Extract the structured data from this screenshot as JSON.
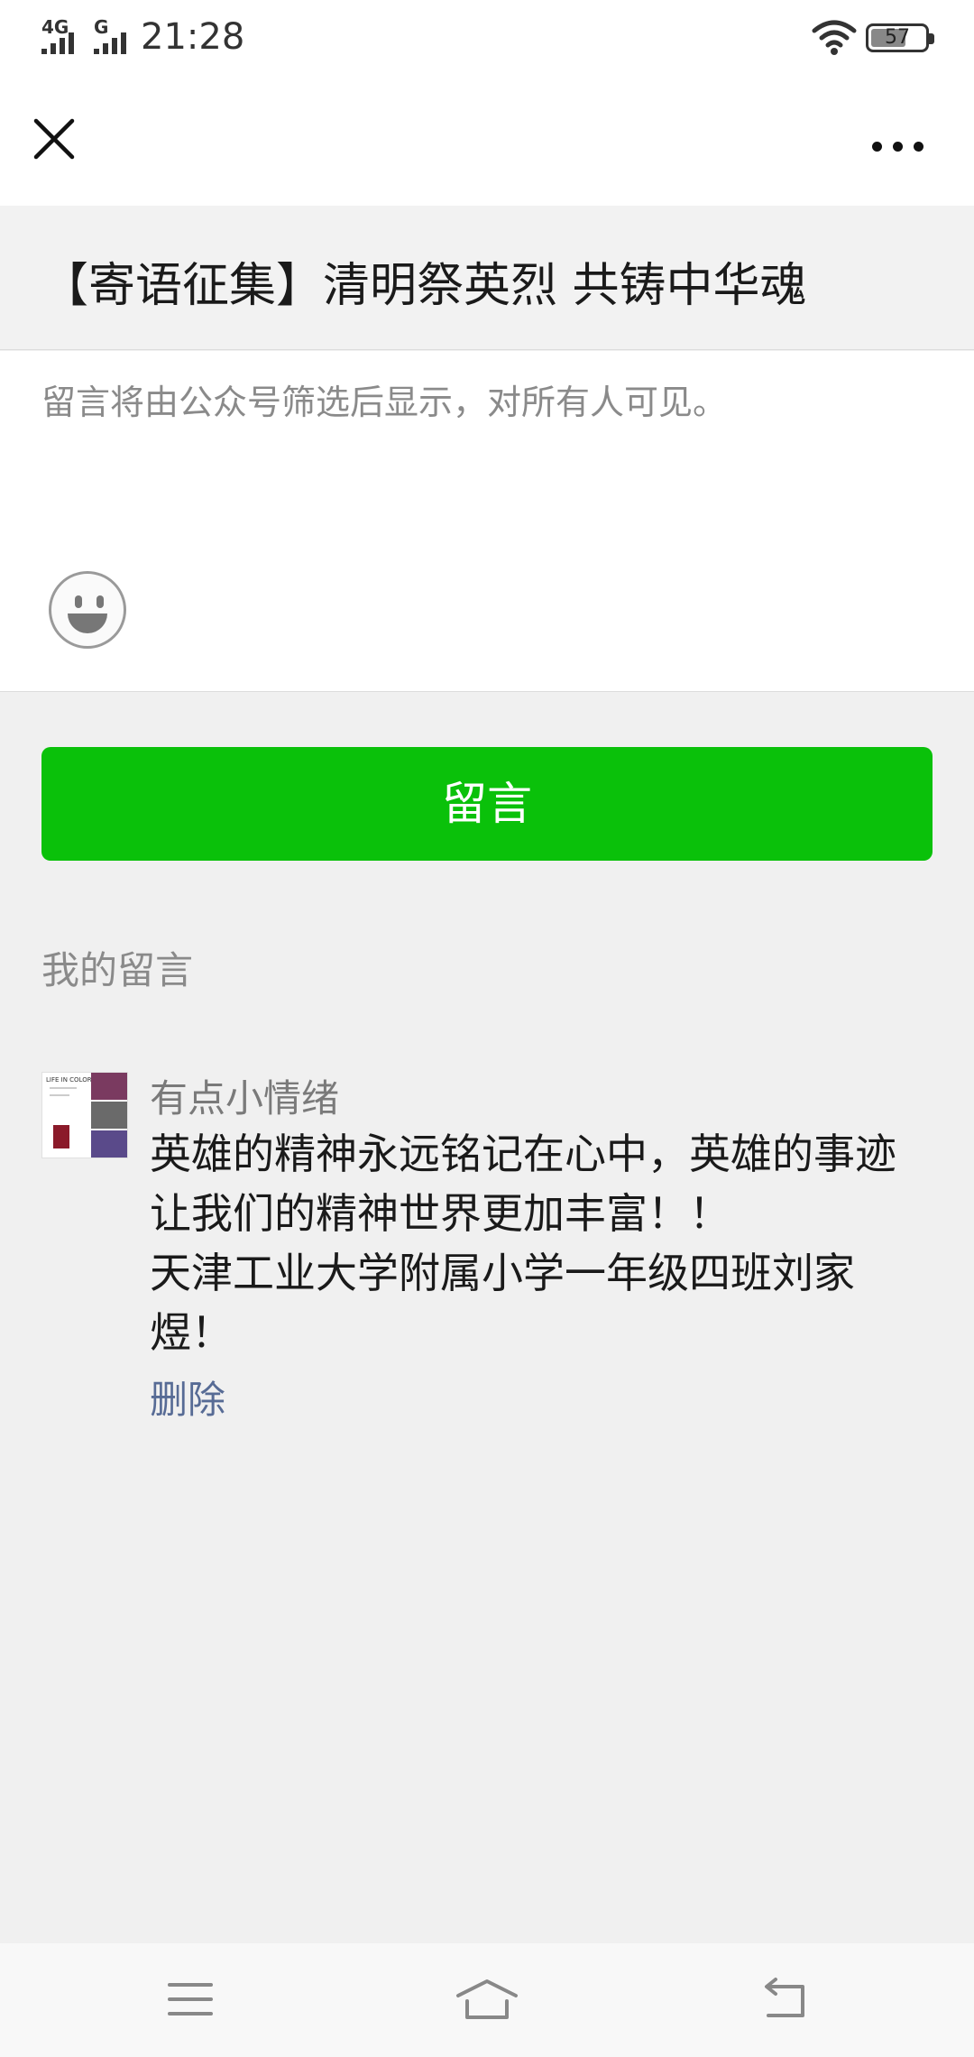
{
  "status_bar": {
    "network_1": "4G",
    "network_2": "G",
    "time": "21:28",
    "battery": "57"
  },
  "nav": {
    "close_icon": "close-icon",
    "more_icon": "more-dots-icon"
  },
  "page": {
    "title": "【寄语征集】清明祭英烈 共铸中华魂"
  },
  "compose": {
    "placeholder": "留言将由公众号筛选后显示，对所有人可见。",
    "emoji_icon": "smiley-face-icon"
  },
  "submit_label": "留言",
  "my_comments": {
    "section_title": "我的留言",
    "items": [
      {
        "author": "有点小情绪",
        "avatar_text": "LIFE IN COLOR",
        "content": "英雄的精神永远铭记在心中，英雄的事迹让我们的精神世界更加丰富！！\n天津工业大学附属小学一年级四班刘家煜！",
        "delete_label": "删除"
      }
    ]
  },
  "colors": {
    "accent_green": "#0ac10a",
    "link_blue": "#576b95",
    "page_bg": "#f0f0f0"
  },
  "system_nav": {
    "menu_icon": "menu-icon",
    "home_icon": "home-icon",
    "back_icon": "back-icon"
  }
}
